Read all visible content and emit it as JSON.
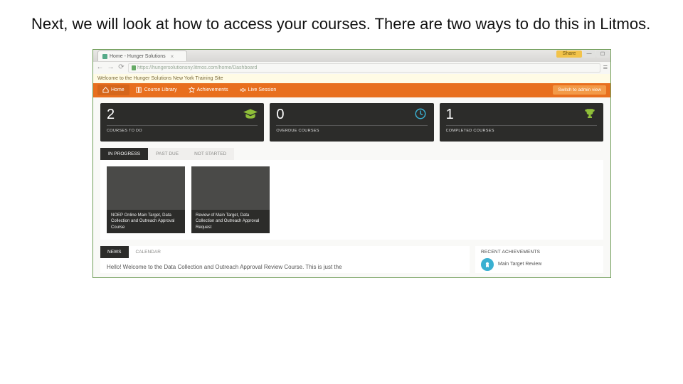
{
  "slide": {
    "heading": "Next, we will look at how to access your courses. There are two ways to do this in Litmos."
  },
  "browser": {
    "tab_title": "Home - Hunger Solutions",
    "url": "https://hungersolutionsny.litmos.com/home/Dashboard",
    "share_label": "Share"
  },
  "welcome_bar": "Welcome to the Hunger Solutions New York Training Site",
  "topnav": {
    "items": [
      {
        "label": "Home",
        "icon": "home"
      },
      {
        "label": "Course Library",
        "icon": "book"
      },
      {
        "label": "Achievements",
        "icon": "star"
      },
      {
        "label": "Live Session",
        "icon": "live"
      }
    ],
    "admin_button": "Switch to admin view"
  },
  "stats": [
    {
      "num": "2",
      "label": "COURSES TO DO",
      "icon": "grad"
    },
    {
      "num": "0",
      "label": "OVERDUE COURSES",
      "icon": "clock"
    },
    {
      "num": "1",
      "label": "COMPLETED COURSES",
      "icon": "trophy"
    }
  ],
  "course_tabs": [
    {
      "label": "IN PROGRESS",
      "active": true
    },
    {
      "label": "PAST DUE",
      "active": false
    },
    {
      "label": "NOT STARTED",
      "active": false
    }
  ],
  "cards": [
    {
      "title": "NOEP Online Main Target, Data Collection and Outreach Approval Course"
    },
    {
      "title": "Review of Main Target, Data Collection and Outreach Approval Request"
    }
  ],
  "news": {
    "tabs": [
      {
        "label": "NEWS",
        "active": true
      },
      {
        "label": "CALENDAR",
        "active": false
      }
    ],
    "body": "Hello! Welcome to the Data Collection and Outreach Approval Review Course. This is just the"
  },
  "achievements": {
    "title": "RECENT ACHIEVEMENTS",
    "item": "Main Target Review"
  }
}
